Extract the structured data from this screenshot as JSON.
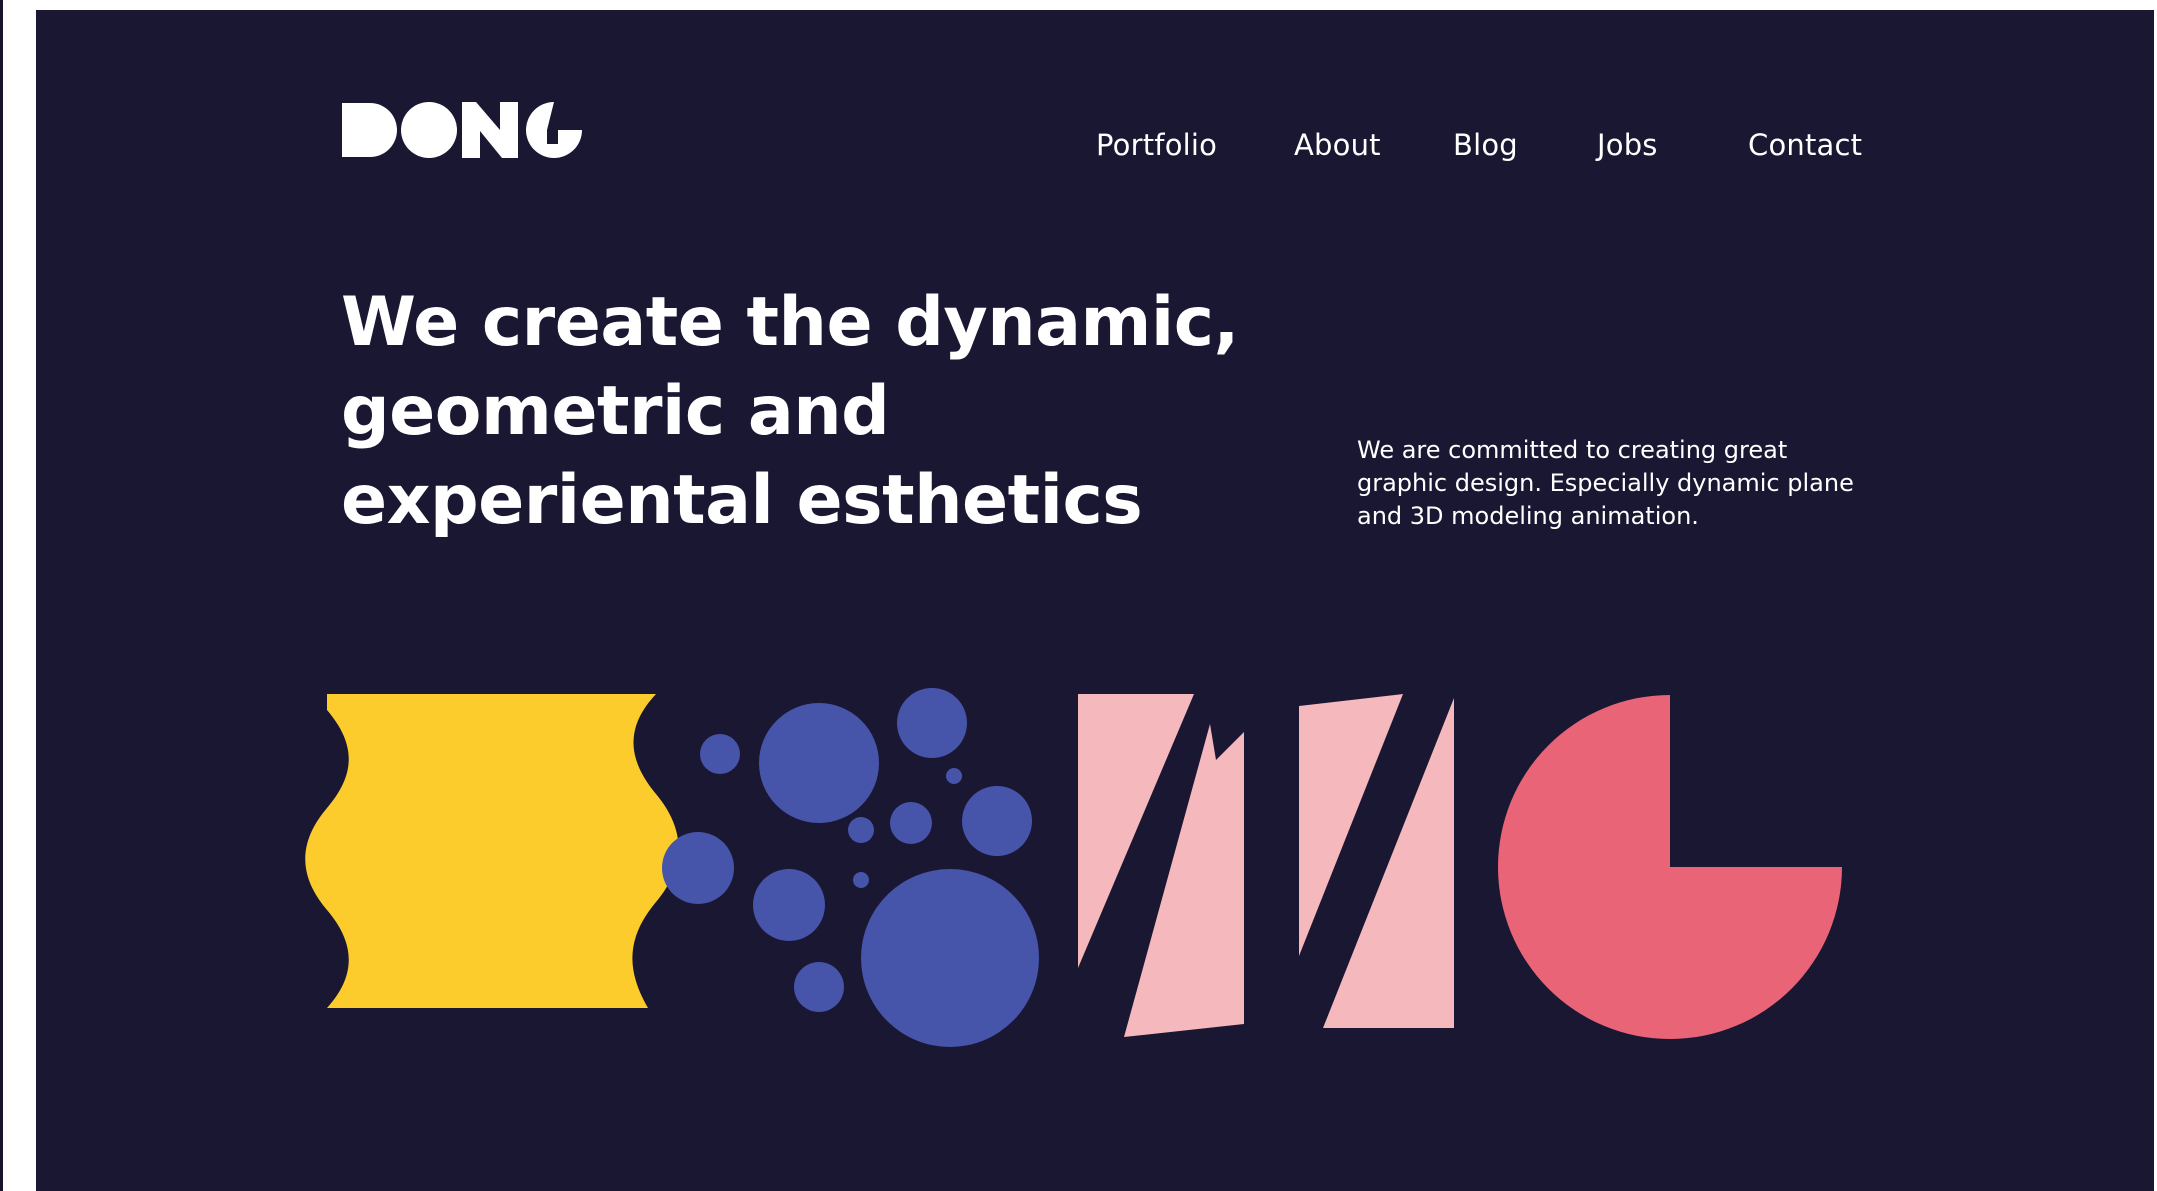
{
  "brand": {
    "logo_text": "DONG"
  },
  "nav": {
    "items": [
      {
        "label": "Portfolio"
      },
      {
        "label": "About"
      },
      {
        "label": "Blog"
      },
      {
        "label": "Jobs"
      },
      {
        "label": "Contact"
      }
    ]
  },
  "hero": {
    "heading_lines": [
      "We create the dynamic,",
      "geometric and",
      "experiental esthetics"
    ],
    "description_lines": [
      "We are committed to creating great",
      "graphic design. Especially dynamic plane",
      "and 3D modeling animation."
    ]
  },
  "colors": {
    "background": "#1a1733",
    "text": "#ffffff",
    "yellow": "#fccc2d",
    "blue": "#4654aa",
    "pink": "#f4b8bd",
    "coral": "#ea6478"
  }
}
